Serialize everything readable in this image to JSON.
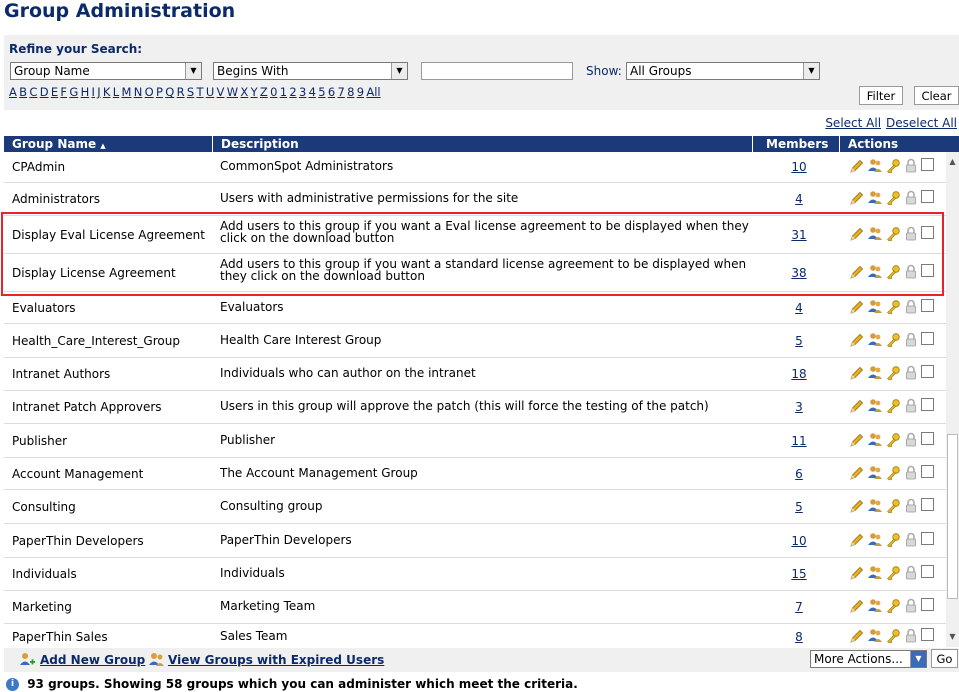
{
  "title": "Group Administration",
  "search": {
    "refine_label": "Refine your Search:",
    "field_select": "Group Name",
    "match_select": "Begins With",
    "text_value": "",
    "show_label": "Show:",
    "show_select": "All Groups",
    "letters": [
      "A",
      "B",
      "C",
      "D",
      "E",
      "F",
      "G",
      "H",
      "I",
      "J",
      "K",
      "L",
      "M",
      "N",
      "O",
      "P",
      "Q",
      "R",
      "S",
      "T",
      "U",
      "V",
      "W",
      "X",
      "Y",
      "Z",
      "0",
      "1",
      "2",
      "3",
      "4",
      "5",
      "6",
      "7",
      "8",
      "9",
      "All"
    ],
    "filter_label": "Filter",
    "clear_label": "Clear"
  },
  "selection": {
    "select_all": "Select All",
    "deselect_all": "Deselect All"
  },
  "table": {
    "headers": {
      "name": "Group Name",
      "description": "Description",
      "members": "Members",
      "actions": "Actions"
    },
    "sort_indicator": "▲",
    "rows": [
      {
        "name": "CPAdmin",
        "description": "CommonSpot Administrators",
        "members": "10"
      },
      {
        "name": "Administrators",
        "description": "Users with administrative permissions for the site",
        "members": "4"
      },
      {
        "name": "Display Eval License Agreement",
        "description": "Add users to this group if you want a Eval license agreement to be displayed when they click on the download button",
        "members": "31"
      },
      {
        "name": "Display License Agreement",
        "description": "Add users to this group if you want a standard license agreement to be displayed when they click on the download button",
        "members": "38"
      },
      {
        "name": "Evaluators",
        "description": "Evaluators",
        "members": "4"
      },
      {
        "name": "Health_Care_Interest_Group",
        "description": "Health Care Interest Group",
        "members": "5"
      },
      {
        "name": "Intranet Authors",
        "description": "Individuals who can author on the intranet",
        "members": "18"
      },
      {
        "name": "Intranet Patch Approvers",
        "description": "Users in this group will approve the patch (this will force the testing of the patch)",
        "members": "3"
      },
      {
        "name": "Publisher",
        "description": "Publisher",
        "members": "11"
      },
      {
        "name": "Account Management",
        "description": "The Account Management Group",
        "members": "6"
      },
      {
        "name": "Consulting",
        "description": "Consulting group",
        "members": "5"
      },
      {
        "name": "PaperThin Developers",
        "description": "PaperThin Developers",
        "members": "10"
      },
      {
        "name": "Individuals",
        "description": "Individuals",
        "members": "15"
      },
      {
        "name": "Marketing",
        "description": "Marketing Team",
        "members": "7"
      },
      {
        "name": "PaperThin Sales",
        "description": "Sales Team",
        "members": "8"
      }
    ]
  },
  "footer": {
    "add_group": "Add New Group",
    "view_expired": "View Groups with Expired Users",
    "more_actions": "More Actions...",
    "go_label": "Go"
  },
  "status_text": "93 groups. Showing 58 groups which you can administer which meet the criteria.",
  "icons": [
    "edit-pencil-icon",
    "group-members-icon",
    "key-permissions-icon",
    "lock-icon",
    "select-checkbox"
  ],
  "colors": {
    "header_bg": "#1b3a7a",
    "title": "#0a2a6a",
    "highlight_box": "#e8242b"
  }
}
